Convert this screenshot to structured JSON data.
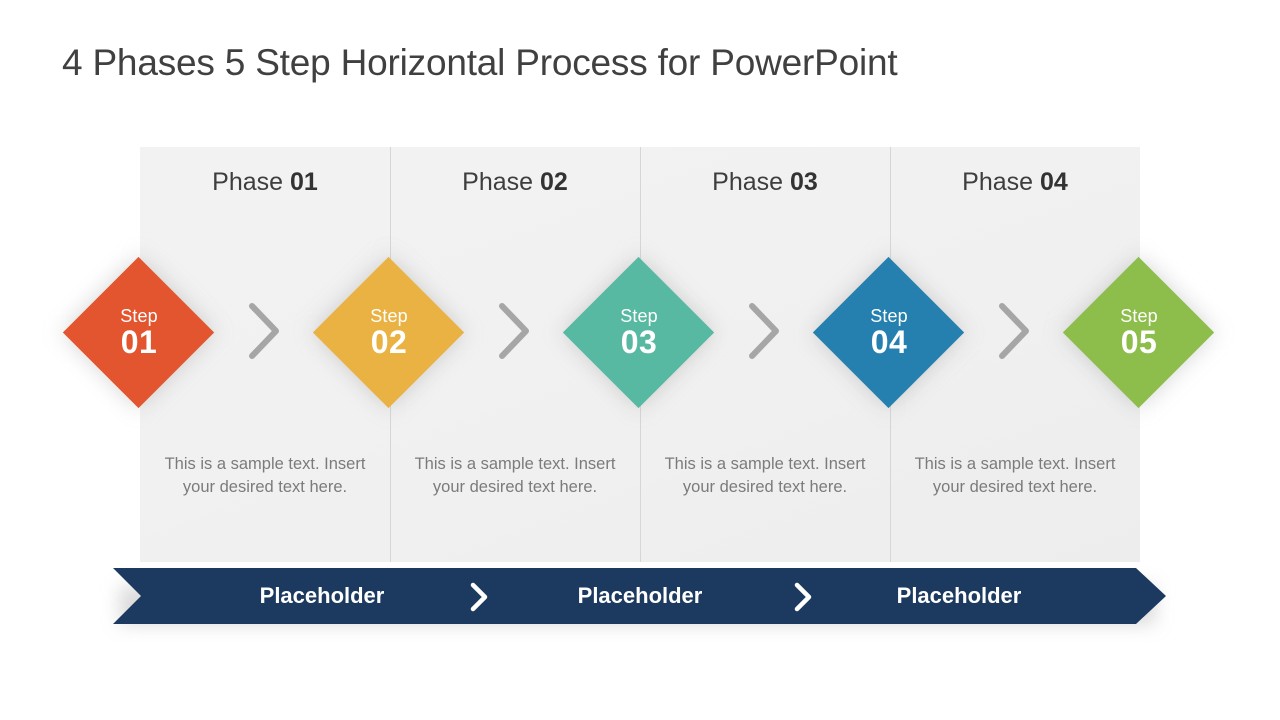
{
  "slide": {
    "title": "4 Phases 5 Step Horizontal Process for PowerPoint",
    "background": "#ffffff",
    "panel_color": "#f1f1f1"
  },
  "phases": [
    {
      "label_word": "Phase",
      "label_num": "01",
      "body": "This is a sample text. Insert your desired text here."
    },
    {
      "label_word": "Phase",
      "label_num": "02",
      "body": "This is a sample text. Insert your desired text here."
    },
    {
      "label_word": "Phase",
      "label_num": "03",
      "body": "This is a sample text. Insert your desired text here."
    },
    {
      "label_word": "Phase",
      "label_num": "04",
      "body": "This is a sample text. Insert your desired text here."
    }
  ],
  "steps": [
    {
      "word": "Step",
      "num": "01",
      "color": "#e2552f"
    },
    {
      "word": "Step",
      "num": "02",
      "color": "#eab243"
    },
    {
      "word": "Step",
      "num": "03",
      "color": "#58b9a2"
    },
    {
      "word": "Step",
      "num": "04",
      "color": "#2580b0"
    },
    {
      "word": "Step",
      "num": "05",
      "color": "#8dbd4b"
    }
  ],
  "step_separators": [
    {
      "icon": "chevron-right-icon",
      "color": "#a6a6a6"
    },
    {
      "icon": "chevron-right-icon",
      "color": "#a6a6a6"
    },
    {
      "icon": "chevron-right-icon",
      "color": "#a6a6a6"
    },
    {
      "icon": "chevron-right-icon",
      "color": "#a6a6a6"
    }
  ],
  "banner": {
    "color": "#1c3a60",
    "text_color": "#ffffff",
    "items": [
      {
        "label": "Placeholder"
      },
      {
        "label": "Placeholder"
      },
      {
        "label": "Placeholder"
      }
    ],
    "separators": [
      {
        "icon": "chevron-right-icon",
        "color": "#ffffff"
      },
      {
        "icon": "chevron-right-icon",
        "color": "#ffffff"
      }
    ]
  }
}
